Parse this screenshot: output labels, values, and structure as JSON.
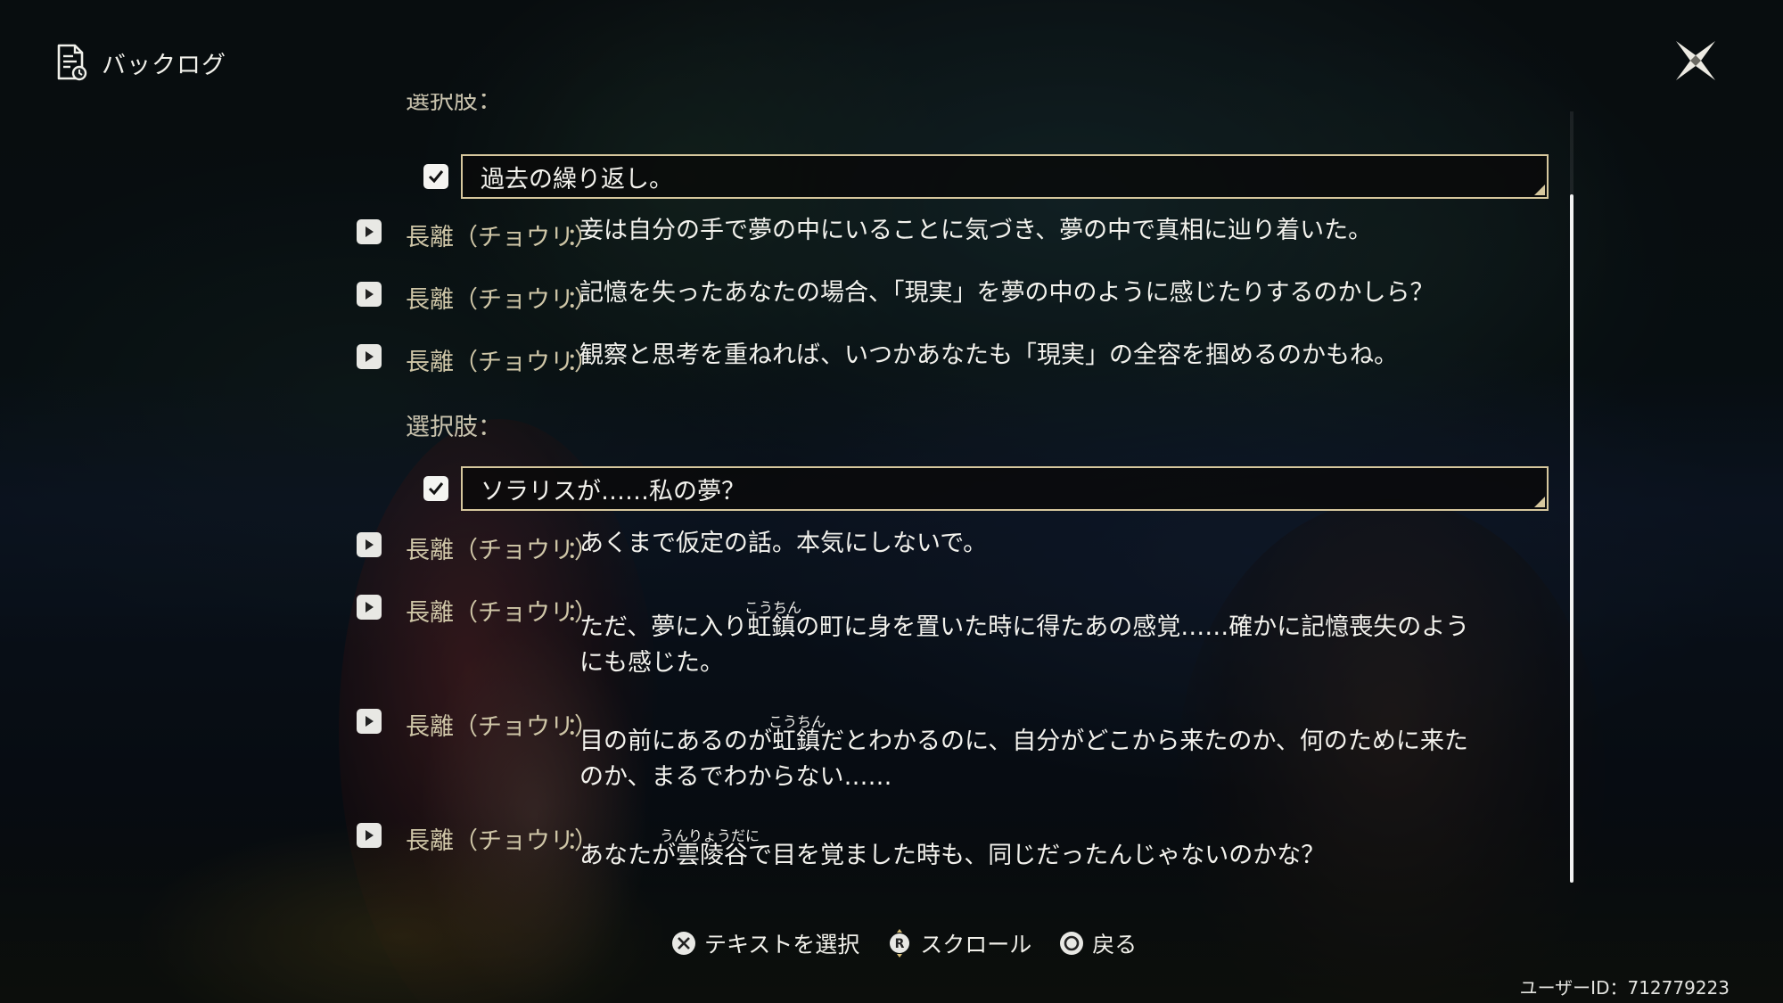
{
  "header": {
    "title": "バックログ",
    "icon": "document-log-icon"
  },
  "close": {
    "icon": "close-x-icon"
  },
  "log": {
    "top_label_partial": "選択肢：",
    "choice1": {
      "label": "過去の繰り返し。",
      "checked": true
    },
    "group1": [
      {
        "speaker": "長離（チョウリ）",
        "text": "妾は自分の手で夢の中にいることに気づき、夢の中で真相に辿り着いた。"
      },
      {
        "speaker": "長離（チョウリ）",
        "text": "記憶を失ったあなたの場合、「現実」を夢の中のように感じたりするのかしら？"
      },
      {
        "speaker": "長離（チョウリ）",
        "text": "観察と思考を重ねれば、いつかあなたも「現実」の全容を掴めるのかもね。"
      }
    ],
    "choice_label": "選択肢：",
    "choice2": {
      "label": "ソラリスが……私の夢？",
      "checked": true
    },
    "group2": [
      {
        "speaker": "長離（チョウリ）",
        "text": "あくまで仮定の話。本気にしないで。"
      },
      {
        "speaker": "長離（チョウリ）",
        "line1": "ただ、夢に入り虹鎮の町に身を置いた時に得たあの感覚……確かに記憶喪失のよう",
        "line2": "にも感じた。",
        "furigana": "こうちん"
      },
      {
        "speaker": "長離（チョウリ）",
        "line1": "目の前にあるのが虹鎮だとわかるのに、自分がどこから来たのか、何のために来た",
        "line2": "のか、まるでわからない……",
        "furigana": "こうちん"
      },
      {
        "speaker": "長離（チョウリ）",
        "line1": "あなたが雲陵谷で目を覚ました時も、同じだったんじゃないのかな？",
        "furigana": "うんりょうだに"
      }
    ]
  },
  "footer": {
    "select_text": "テキストを選択",
    "scroll": "スクロール",
    "back": "戻る"
  },
  "user_id": "ユーザーID：712779223"
}
